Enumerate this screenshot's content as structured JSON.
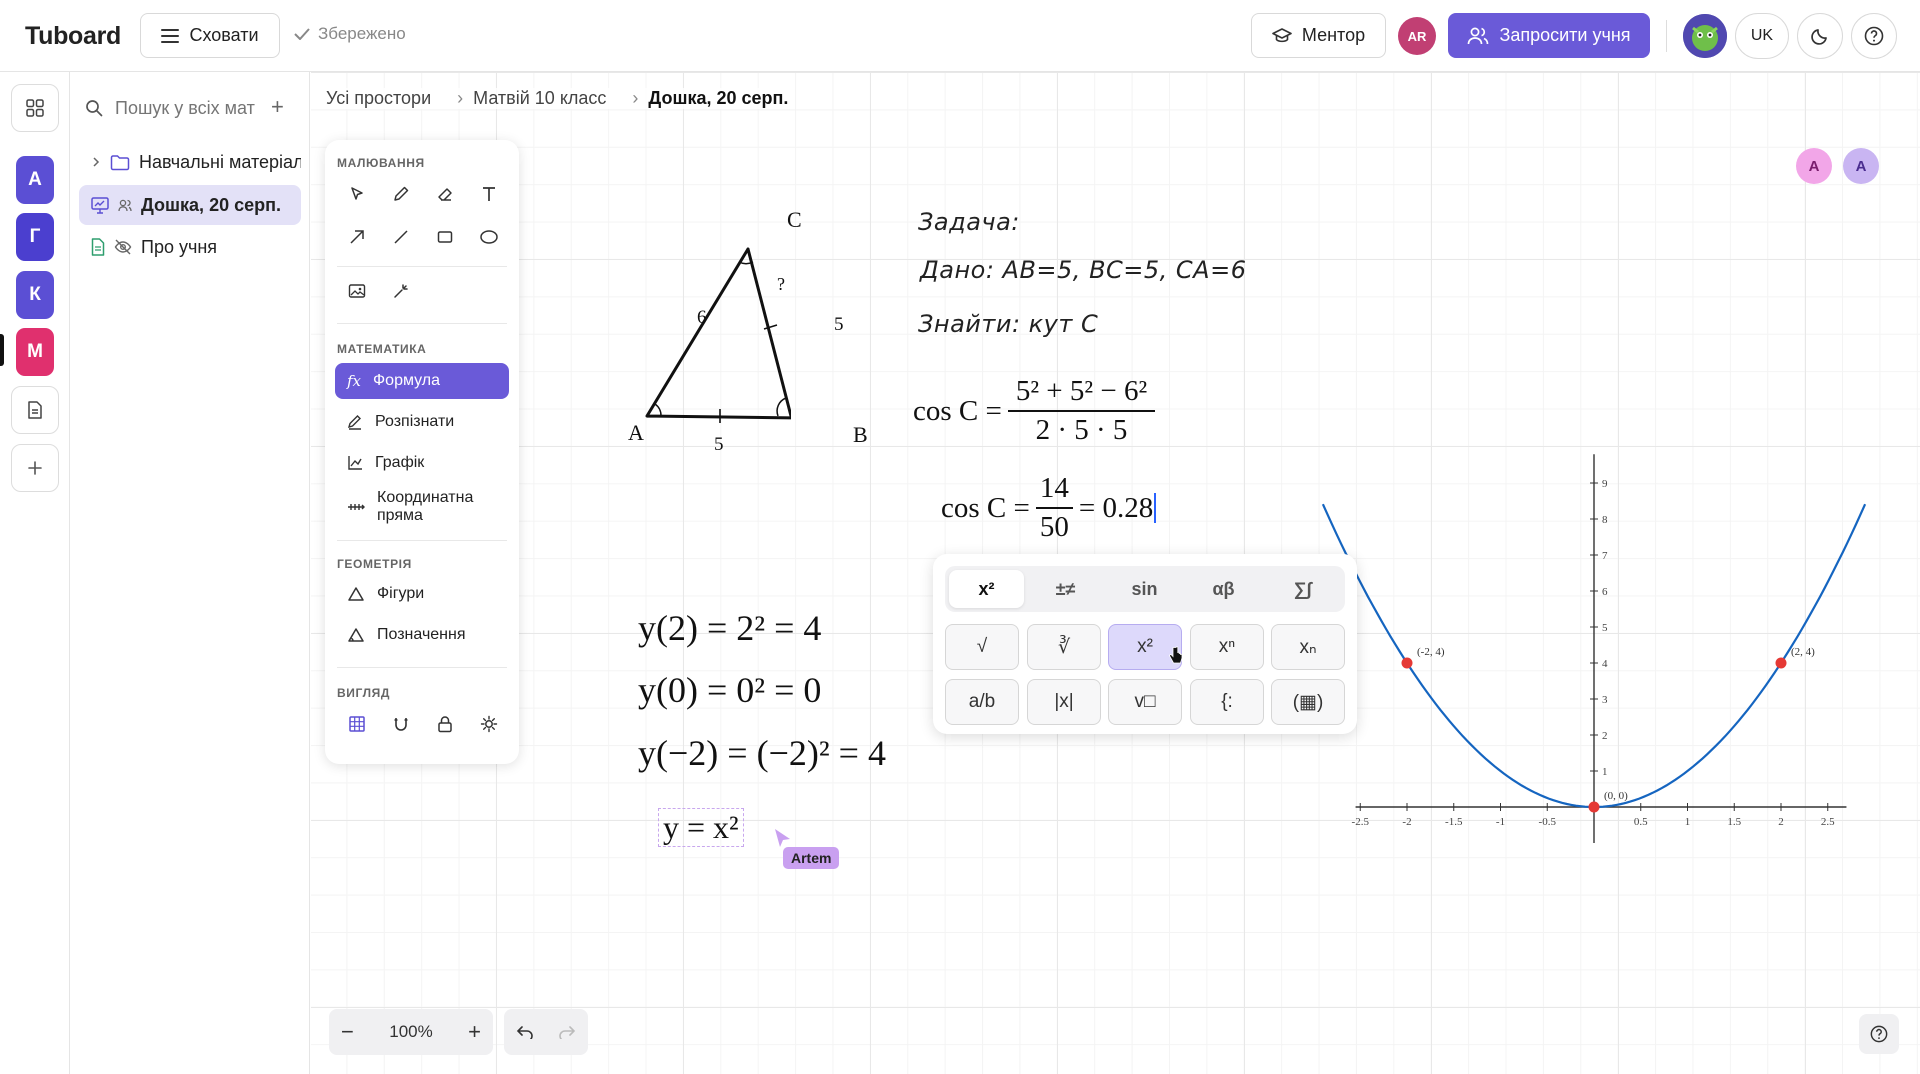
{
  "app": {
    "name": "Tuboard"
  },
  "header": {
    "hide_label": "Сховати",
    "saved_label": "Збережено",
    "mentor_label": "Ментор",
    "avatar_initials": "AR",
    "invite_label": "Запросити учня",
    "language": "UK"
  },
  "rail": {
    "spaces": [
      {
        "letter": "А",
        "color": "#5b4fd4"
      },
      {
        "letter": "Г",
        "color": "#4b3fcf"
      },
      {
        "letter": "К",
        "color": "#5b4fd4"
      },
      {
        "letter": "М",
        "color": "#e0306e"
      }
    ]
  },
  "sidebar": {
    "search_placeholder": "Пошук у всіх матеріалах",
    "items": [
      {
        "label": "Навчальні матеріали"
      },
      {
        "label": "Дошка, 20 серп."
      },
      {
        "label": "Про учня"
      }
    ]
  },
  "breadcrumb": [
    "Усі простори",
    "Матвій 10 класс",
    "Дошка, 20 серп."
  ],
  "tools": {
    "sections": {
      "draw": "МАЛЮВАННЯ",
      "math": "МАТЕМАТИКА",
      "geometry": "ГЕОМЕТРІЯ",
      "view": "ВИГЛЯД"
    },
    "math_items": [
      "Формула",
      "Розпізнати",
      "Графік",
      "Координатна пряма"
    ],
    "geometry_items": [
      "Фігури",
      "Позначення"
    ]
  },
  "triangle": {
    "vertices": [
      "A",
      "B",
      "C"
    ],
    "side_ab": "5",
    "side_bc": "5",
    "side_ca": "6",
    "angle_c": "?"
  },
  "problem": {
    "title": "Задача:",
    "given": "Дано: AB=5, BC=5, CA=6",
    "find": "Знайти: кут C"
  },
  "formulas": {
    "cos_lhs": "cos C =",
    "cos_num": "5² + 5² − 6²",
    "cos_den": "2 · 5 · 5",
    "cos2_lhs": "cos C =",
    "cos2_num": "14",
    "cos2_den": "50",
    "cos2_rhs": "= 0.28",
    "y2": "y(2) = 2² = 4",
    "y0": "y(0) = 0² = 0",
    "ym2": "y(−2) = (−2)² = 4",
    "fx": "y = x²"
  },
  "collaborator": {
    "name": "Artem"
  },
  "keyboard": {
    "tabs": [
      "x²",
      "±≠",
      "sin",
      "αβ",
      "∑∫"
    ],
    "row1": [
      "√",
      "∛",
      "x²",
      "xⁿ",
      "xₙ"
    ],
    "row2": [
      "a/b",
      "|x|",
      "v□",
      "{:",
      "(▦)"
    ]
  },
  "graph": {
    "points": [
      "(-2, 4)",
      "(2, 4)",
      "(0, 0)"
    ],
    "x_ticks": [
      "-2.5",
      "-2",
      "-1.5",
      "-1",
      "-0.5",
      "0.5",
      "1",
      "1.5",
      "2",
      "2.5"
    ],
    "y_ticks": [
      "1",
      "2",
      "3",
      "4",
      "5",
      "6",
      "7",
      "8",
      "9"
    ]
  },
  "canvas_users": [
    "A",
    "A"
  ],
  "zoom": {
    "level": "100%"
  },
  "colors": {
    "accent": "#6a5ad8",
    "curve": "#1565c0",
    "point": "#e53935"
  }
}
